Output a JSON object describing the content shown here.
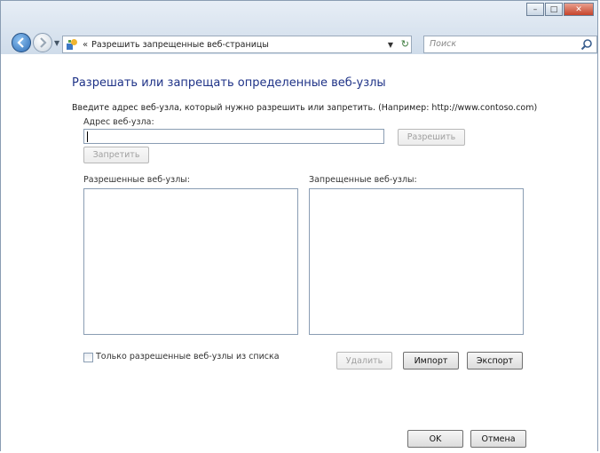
{
  "window": {
    "controls": {
      "minimize": "–",
      "maximize": "□",
      "close": "✕"
    }
  },
  "nav": {
    "back_icon": "back-arrow-icon",
    "forward_icon": "forward-arrow-icon",
    "address": {
      "chevron": "«",
      "text": "Разрешить запрещенные веб-страницы"
    },
    "search": {
      "placeholder": "Поиск"
    }
  },
  "page": {
    "title": "Разрешать или запрещать определенные веб-узлы",
    "instruction": "Введите адрес веб-узла, который нужно разрешить или запретить. (Например: http://www.contoso.com)",
    "address_label": "Адрес веб-узла:",
    "address_value": "",
    "allow_button": "Разрешить",
    "block_button": "Запретить",
    "allowed_label": "Разрешенные веб-узлы:",
    "blocked_label": "Запрещенные веб-узлы:",
    "allowed_items": [],
    "blocked_items": [],
    "only_allowed_checkbox": "Только разрешенные веб-узлы из списка",
    "only_allowed_checked": false,
    "delete_button": "Удалить",
    "import_button": "Импорт",
    "export_button": "Экспорт",
    "ok_button": "OK",
    "cancel_button": "Отмена"
  }
}
